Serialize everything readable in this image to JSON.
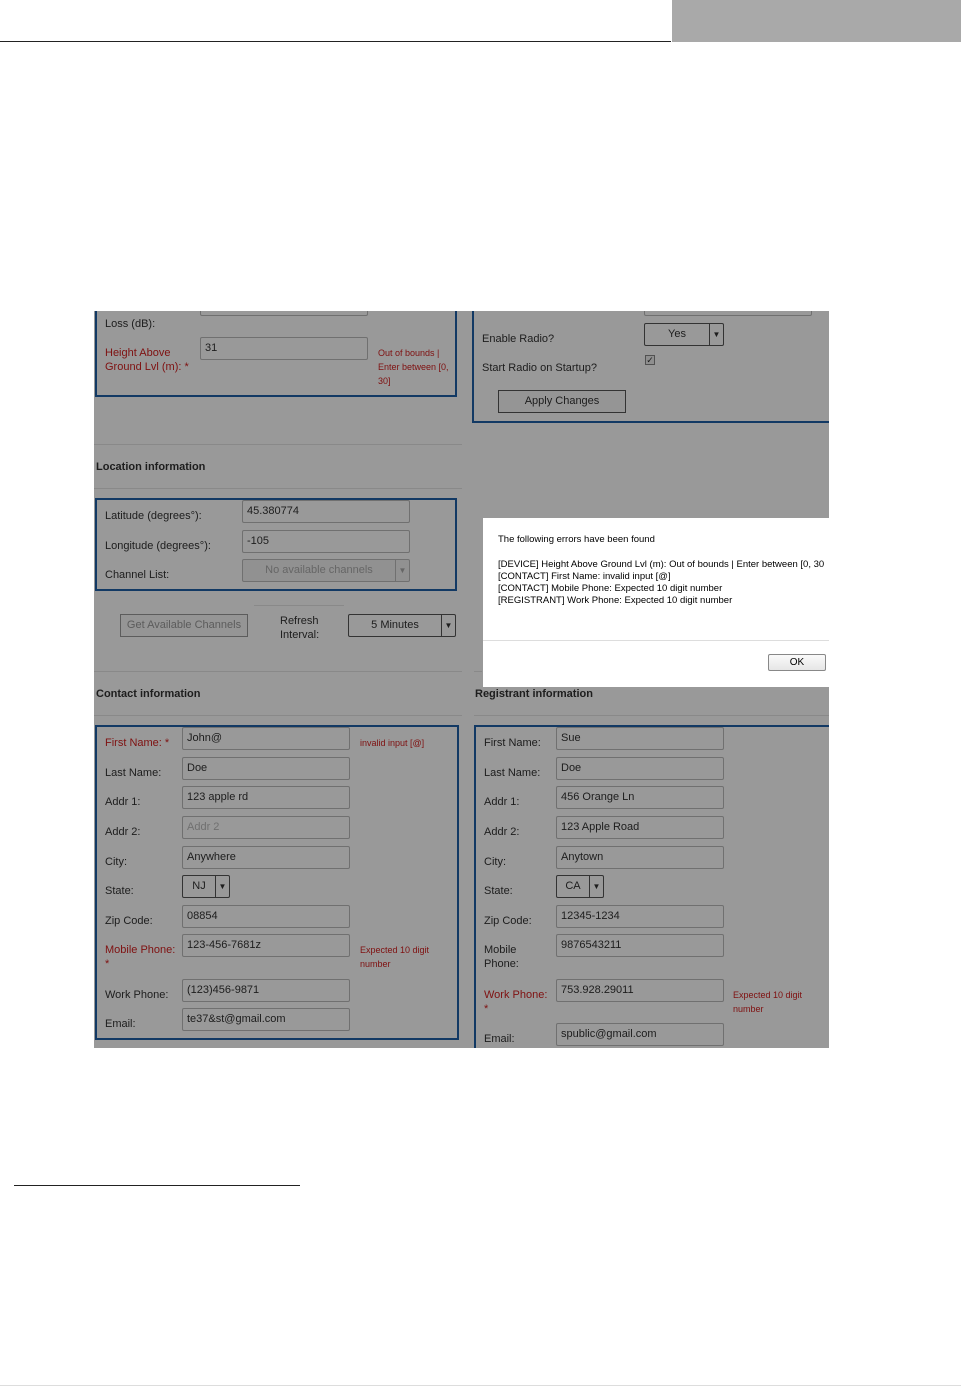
{
  "device": {
    "loss_label": "Loss (dB):",
    "height_label": "Height Above Ground Lvl (m): *",
    "height_value": "31",
    "height_error": "Out of bounds | Enter between [0, 30]"
  },
  "radio": {
    "enable_label": "Enable Radio?",
    "enable_value": "Yes",
    "startup_label": "Start Radio on Startup?",
    "startup_checked": "✓",
    "apply_button": "Apply Changes"
  },
  "location": {
    "heading": "Location information",
    "latitude_label": "Latitude (degrees°):",
    "latitude_value": "45.380774",
    "longitude_label": "Longitude (degrees°):",
    "longitude_value": "-105",
    "channel_label": "Channel List:",
    "channel_value": "No available channels",
    "get_channels_button": "Get Available Channels",
    "refresh_label": "Refresh Interval:",
    "refresh_value": "5 Minutes"
  },
  "contact": {
    "heading": "Contact information",
    "first_name_label": "First Name: *",
    "first_name_value": "John@",
    "first_name_error": "invalid input [@]",
    "last_name_label": "Last Name:",
    "last_name_value": "Doe",
    "addr1_label": "Addr 1:",
    "addr1_value": "123 apple rd",
    "addr2_label": "Addr 2:",
    "addr2_placeholder": "Addr 2",
    "city_label": "City:",
    "city_value": "Anywhere",
    "state_label": "State:",
    "state_value": "NJ",
    "zip_label": "Zip Code:",
    "zip_value": "08854",
    "mobile_label": "Mobile Phone: *",
    "mobile_value": "123-456-7681z",
    "mobile_error": "Expected 10 digit number",
    "work_label": "Work Phone:",
    "work_value": "(123)456-9871",
    "email_label": "Email:",
    "email_value": "te37&st@gmail.com"
  },
  "registrant": {
    "heading": "Registrant information",
    "first_name_label": "First Name:",
    "first_name_value": "Sue",
    "last_name_label": "Last Name:",
    "last_name_value": "Doe",
    "addr1_label": "Addr 1:",
    "addr1_value": "456 Orange Ln",
    "addr2_label": "Addr 2:",
    "addr2_value": "123 Apple Road",
    "city_label": "City:",
    "city_value": "Anytown",
    "state_label": "State:",
    "state_value": "CA",
    "zip_label": "Zip Code:",
    "zip_value": "12345-1234",
    "mobile_label": "Mobile Phone:",
    "mobile_value": "9876543211",
    "work_label": "Work Phone: *",
    "work_value": "753.928.29011",
    "work_error": "Expected 10 digit number",
    "email_label": "Email:",
    "email_value": "spublic@gmail.com"
  },
  "dialog": {
    "title": "The following errors have been found",
    "errors": [
      "[DEVICE] Height Above Ground Lvl (m): Out of bounds | Enter between [0, 30",
      "[CONTACT] First Name: invalid input [@]",
      "[CONTACT] Mobile Phone: Expected 10 digit number",
      "[REGISTRANT] Work Phone: Expected 10 digit number"
    ],
    "ok_button": "OK"
  },
  "colors": {
    "panel_border": "#1f5fa7",
    "error_text": "#d42020",
    "overlay": "rgba(0,0,0,0.40)"
  }
}
